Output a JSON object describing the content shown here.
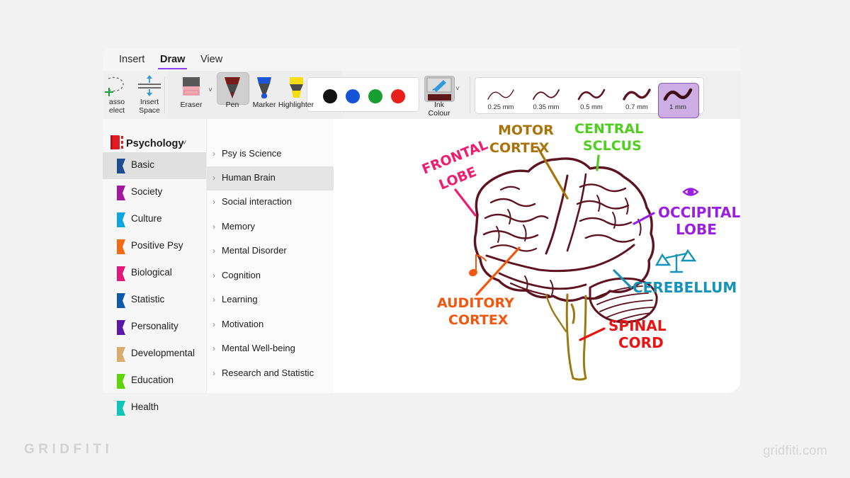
{
  "watermarks": {
    "left": "GRIDFITI",
    "right": "gridfiti.com"
  },
  "menubar": {
    "items": [
      {
        "label": "Insert",
        "active": false
      },
      {
        "label": "Draw",
        "active": true
      },
      {
        "label": "View",
        "active": false
      }
    ]
  },
  "ribbon": {
    "tools": [
      {
        "name": "lasso-select",
        "label_line1": "asso",
        "label_line2": "elect"
      },
      {
        "name": "insert-space",
        "label_line1": "Insert",
        "label_line2": "Space"
      }
    ],
    "pens": [
      {
        "name": "eraser",
        "label": "Eraser",
        "selected": false
      },
      {
        "name": "pen",
        "label": "Pen",
        "selected": true
      },
      {
        "name": "marker",
        "label": "Marker",
        "selected": false
      },
      {
        "name": "highlighter",
        "label": "Highlighter",
        "selected": false
      }
    ],
    "colours": [
      {
        "name": "black",
        "hex": "#111111"
      },
      {
        "name": "blue",
        "hex": "#1455d6"
      },
      {
        "name": "green",
        "hex": "#17a02f"
      },
      {
        "name": "red",
        "hex": "#e8201a"
      }
    ],
    "ink": {
      "label_line1": "Ink",
      "label_line2": "Colour",
      "current_hex": "#5e1a1a"
    },
    "widths": [
      {
        "label": "0.25 mm",
        "selected": false,
        "px": 1.4
      },
      {
        "label": "0.35 mm",
        "selected": false,
        "px": 1.9
      },
      {
        "label": "0.5 mm",
        "selected": false,
        "px": 2.6
      },
      {
        "label": "0.7 mm",
        "selected": false,
        "px": 3.4
      },
      {
        "label": "1 mm",
        "selected": true,
        "px": 4.6
      }
    ],
    "width_selected_hex": "#cdaee4"
  },
  "sidebar": {
    "notebook": {
      "title": "Psychology",
      "icon_hex": "#e01b22"
    },
    "sections": [
      {
        "label": "Basic",
        "hex": "#1c4d8f",
        "active": true
      },
      {
        "label": "Society",
        "hex": "#a3199c",
        "active": false
      },
      {
        "label": "Culture",
        "hex": "#0fa5e0",
        "active": false
      },
      {
        "label": "Positive Psy",
        "hex": "#f26a14",
        "active": false
      },
      {
        "label": "Biological",
        "hex": "#e0197a",
        "active": false
      },
      {
        "label": "Statistic",
        "hex": "#1058a8",
        "active": false
      },
      {
        "label": "Personality",
        "hex": "#5b17a8",
        "active": false
      },
      {
        "label": "Developmental",
        "hex": "#d9ac6e",
        "active": false
      },
      {
        "label": "Education",
        "hex": "#5ed409",
        "active": false
      },
      {
        "label": "Health",
        "hex": "#10c4b8",
        "active": false
      }
    ]
  },
  "pagelist": {
    "pages": [
      {
        "label": "Psy is Science",
        "active": false
      },
      {
        "label": "Human Brain",
        "active": true
      },
      {
        "label": "Social interaction",
        "active": false
      },
      {
        "label": "Memory",
        "active": false
      },
      {
        "label": "Mental Disorder",
        "active": false
      },
      {
        "label": "Cognition",
        "active": false
      },
      {
        "label": "Learning",
        "active": false
      },
      {
        "label": "Motivation",
        "active": false
      },
      {
        "label": "Mental Well-being",
        "active": false
      },
      {
        "label": "Research and Statistic",
        "active": false
      }
    ]
  },
  "canvas": {
    "drawing_name": "human-brain-sketch",
    "brain_outline_hex": "#5d1420",
    "brainstem_hex": "#9b7a16",
    "annotations": [
      {
        "name": "frontal-lobe",
        "line1": "FRONTAL",
        "line2": "LOBE",
        "hex": "#ee1d6e"
      },
      {
        "name": "motor-cortex",
        "line1": "MOTOR",
        "line2": "CORTEX",
        "hex": "#a8740a"
      },
      {
        "name": "central-sulcus",
        "line1": "CENTRAL",
        "line2": "SCLCUS",
        "hex": "#4ecf1e"
      },
      {
        "name": "occipital-lobe",
        "line1": "OCCIPITAL",
        "line2": "LOBE",
        "hex": "#9b1fe0"
      },
      {
        "name": "cerebellum",
        "line1": "CEREBELLUM",
        "line2": "",
        "hex": "#1593b8"
      },
      {
        "name": "auditory-cortex",
        "line1": "AUDITORY",
        "line2": "CORTEX",
        "hex": "#f0580f"
      },
      {
        "name": "spinal-cord",
        "line1": "SPINAL",
        "line2": "CORD",
        "hex": "#e81414"
      }
    ],
    "doodles": [
      {
        "name": "eye-icon",
        "hex": "#9b1fe0"
      },
      {
        "name": "balance-scale-icon",
        "hex": "#1593b8"
      },
      {
        "name": "music-note-icon",
        "hex": "#f0580f"
      }
    ]
  }
}
